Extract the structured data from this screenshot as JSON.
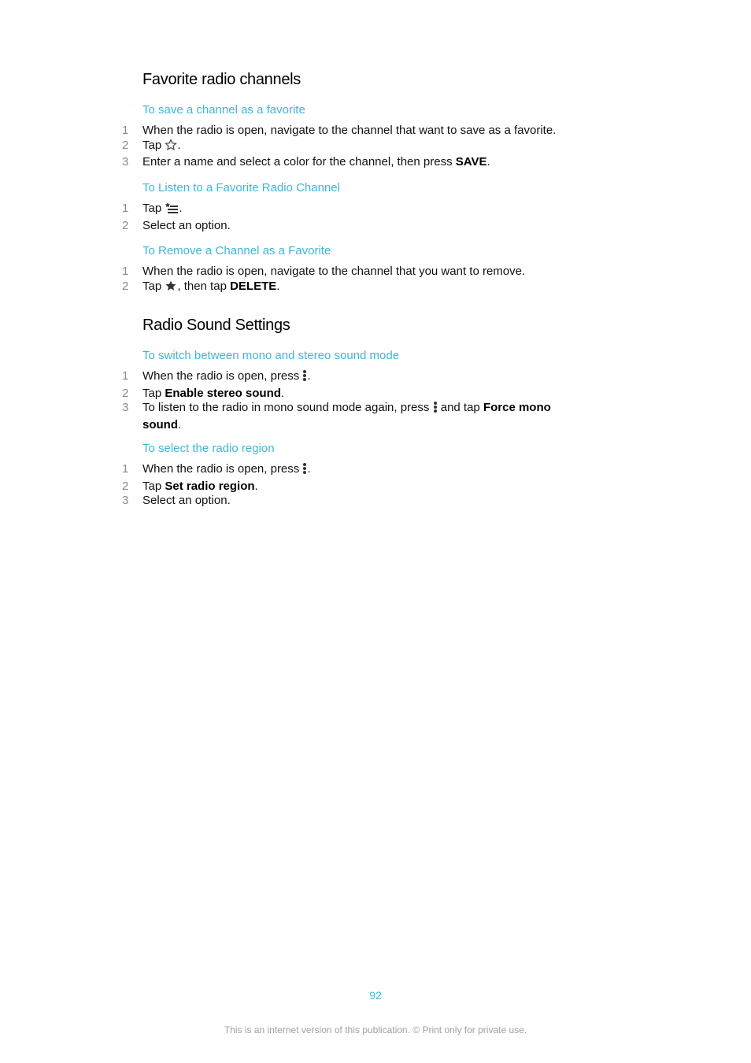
{
  "sections": [
    {
      "title": "Favorite radio channels",
      "procedures": [
        {
          "heading": "To save a channel as a favorite",
          "steps": [
            {
              "num": "1",
              "text": "When the radio is open, navigate to the channel that want to save as a favorite."
            },
            {
              "num": "2",
              "pre": "Tap ",
              "icon": "star-outline-icon",
              "post": "."
            },
            {
              "num": "3",
              "pre": "Enter a name and select a color for the channel, then press ",
              "bold": "SAVE",
              "post": "."
            }
          ]
        },
        {
          "heading": "To Listen to a Favorite Radio Channel",
          "steps": [
            {
              "num": "1",
              "pre": "Tap ",
              "icon": "favorites-list-icon",
              "post": "."
            },
            {
              "num": "2",
              "text": "Select an option."
            }
          ]
        },
        {
          "heading": "To Remove a Channel as a Favorite",
          "steps": [
            {
              "num": "1",
              "text": "When the radio is open, navigate to the channel that you want to remove."
            },
            {
              "num": "2",
              "pre": "Tap ",
              "icon": "star-filled-icon",
              "mid": ", then tap ",
              "bold": "DELETE",
              "post": "."
            }
          ]
        }
      ]
    },
    {
      "title": "Radio Sound Settings",
      "procedures": [
        {
          "heading": "To switch between mono and stereo sound mode",
          "steps": [
            {
              "num": "1",
              "pre": "When the radio is open, press ",
              "icon": "more-vert-icon",
              "post": "."
            },
            {
              "num": "2",
              "pre": "Tap ",
              "bold": "Enable stereo sound",
              "post": "."
            },
            {
              "num": "3",
              "pre": "To listen to the radio in mono sound mode again, press ",
              "icon": "more-vert-icon",
              "mid": " and tap ",
              "bold": "Force mono sound",
              "post": "."
            }
          ]
        },
        {
          "heading": "To select the radio region",
          "steps": [
            {
              "num": "1",
              "pre": "When the radio is open, press ",
              "icon": "more-vert-icon",
              "post": "."
            },
            {
              "num": "2",
              "pre": "Tap ",
              "bold": "Set radio region",
              "post": "."
            },
            {
              "num": "3",
              "text": "Select an option."
            }
          ]
        }
      ]
    }
  ],
  "footer": {
    "page_number": "92",
    "note": "This is an internet version of this publication. © Print only for private use."
  }
}
